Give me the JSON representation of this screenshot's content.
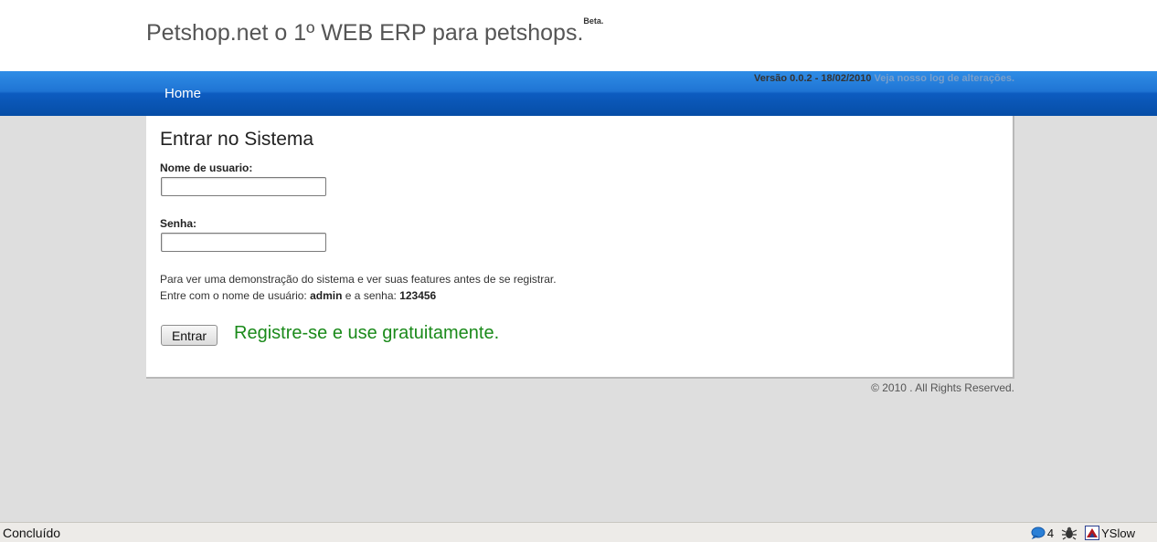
{
  "header": {
    "site_title": "Petshop.net o 1º WEB ERP para petshops.",
    "beta_badge": "Beta."
  },
  "nav": {
    "home_label": "Home",
    "version_text": "Versão 0.0.2 - 18/02/2010",
    "changelog_link": "Veja nosso log de alterações."
  },
  "login": {
    "title": "Entrar no Sistema",
    "username_label": "Nome de usuario:",
    "username_value": "",
    "password_label": "Senha:",
    "password_value": "",
    "info_line1": "Para ver uma demonstração do sistema e ver suas features antes de se registrar.",
    "info_line2_prefix": "Entre com o nome de usuário:",
    "demo_user": "admin",
    "info_line2_mid": "e a senha:",
    "demo_password": "123456",
    "submit_label": "Entrar",
    "register_link": "Registre-se e use gratuitamente."
  },
  "footer": {
    "copyright": "© 2010 . All Rights Reserved."
  },
  "statusbar": {
    "status_text": "Concluído",
    "chat_count": "4",
    "yslow_label": "YSlow"
  },
  "colors": {
    "nav_blue": "#1f74d4",
    "register_green": "#1a8a1a",
    "changelog_link": "#7a9fca"
  }
}
